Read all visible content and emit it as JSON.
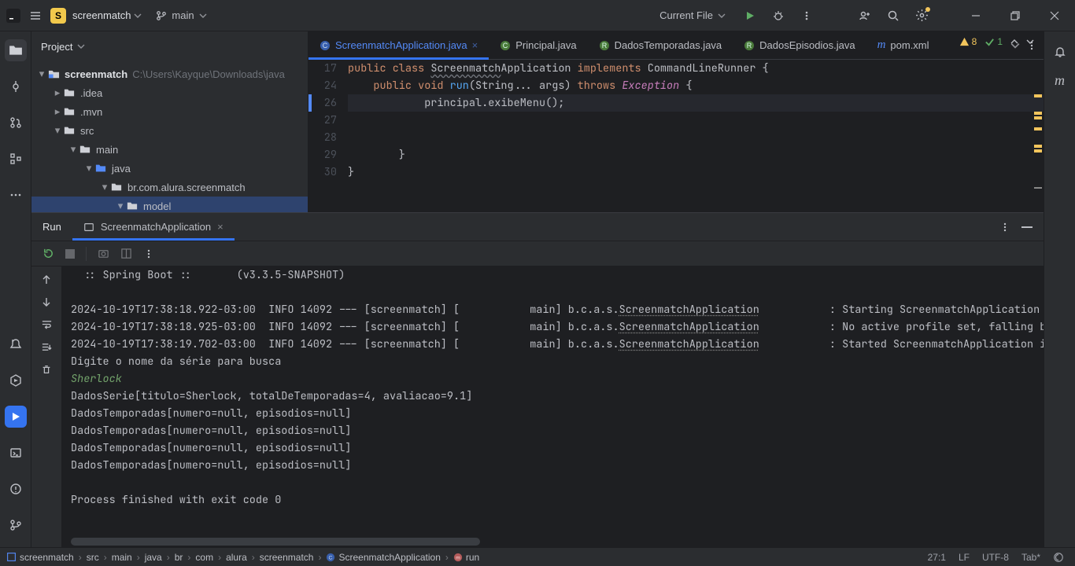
{
  "titlebar": {
    "projectLetter": "S",
    "projectName": "screenmatch",
    "branch": "main",
    "runConfig": "Current File"
  },
  "projectPanel": {
    "title": "Project",
    "root": "screenmatch",
    "rootPath": "C:\\Users\\Kayque\\Downloads\\java",
    "nodes": {
      "idea": ".idea",
      "mvn": ".mvn",
      "src": "src",
      "main": "main",
      "java": "java",
      "pkg": "br.com.alura.screenmatch",
      "model": "model"
    }
  },
  "tabs": [
    {
      "label": "ScreenmatchApplication.java",
      "active": true,
      "iconColor": "#548af7"
    },
    {
      "label": "Principal.java",
      "active": false,
      "iconColor": "#6aab73"
    },
    {
      "label": "DadosTemporadas.java",
      "active": false,
      "iconColor": "#6aab73"
    },
    {
      "label": "DadosEpisodios.java",
      "active": false,
      "iconColor": "#6aab73"
    },
    {
      "label": "pom.xml",
      "active": false,
      "iconColor": "#c77dbb",
      "isPom": true
    }
  ],
  "inspections": {
    "warn": "8",
    "ok": "1"
  },
  "code": {
    "lines": [
      "17",
      "24",
      "26",
      "27",
      "28",
      "29",
      "30"
    ],
    "l17a": "public ",
    "l17b": "class ",
    "l17c": "Screenmatch",
    "l17d": "Application ",
    "l17e": "implements ",
    "l17f": "CommandLineRunner {",
    "l24a": "public ",
    "l24b": "void ",
    "l24c": "run",
    "l24d": "(String... args) ",
    "l24e": "throws ",
    "l24f": "Exception",
    "l24g": " {",
    "l26": "            principal.exibeMenu();",
    "l28": "        }",
    "l29": "}"
  },
  "runPanel": {
    "title": "Run",
    "tab": "ScreenmatchApplication"
  },
  "console": {
    "l1": "  :: Spring Boot ::       (v3.3.5-SNAPSHOT)",
    "l2": "",
    "l3a": "2024-10-19T17:38:18.922-03:00  INFO 14092 --- [screenmatch] [           main] b.c.a.s.",
    "l3b": "ScreenmatchApplication",
    "l3c": "           : Starting ScreenmatchApplication us",
    "l4a": "2024-10-19T17:38:18.925-03:00  INFO 14092 --- [screenmatch] [           main] b.c.a.s.",
    "l4b": "ScreenmatchApplication",
    "l4c": "           : No active profile set, falling ba",
    "l5a": "2024-10-19T17:38:19.702-03:00  INFO 14092 --- [screenmatch] [           main] b.c.a.s.",
    "l5b": "ScreenmatchApplication",
    "l5c": "           : Started ScreenmatchApplication in",
    "l6": "Digite o nome da série para busca",
    "l7": "Sherlock",
    "l8": "DadosSerie[titulo=Sherlock, totalDeTemporadas=4, avaliacao=9.1]",
    "l9": "DadosTemporadas[numero=null, episodios=null]",
    "l10": "DadosTemporadas[numero=null, episodios=null]",
    "l11": "DadosTemporadas[numero=null, episodios=null]",
    "l12": "DadosTemporadas[numero=null, episodios=null]",
    "l13": "",
    "l14": "Process finished with exit code 0"
  },
  "breadcrumbs": [
    "screenmatch",
    "src",
    "main",
    "java",
    "br",
    "com",
    "alura",
    "screenmatch",
    "ScreenmatchApplication",
    "run"
  ],
  "status": {
    "pos": "27:1",
    "eol": "LF",
    "enc": "UTF-8",
    "indent": "Tab*"
  }
}
